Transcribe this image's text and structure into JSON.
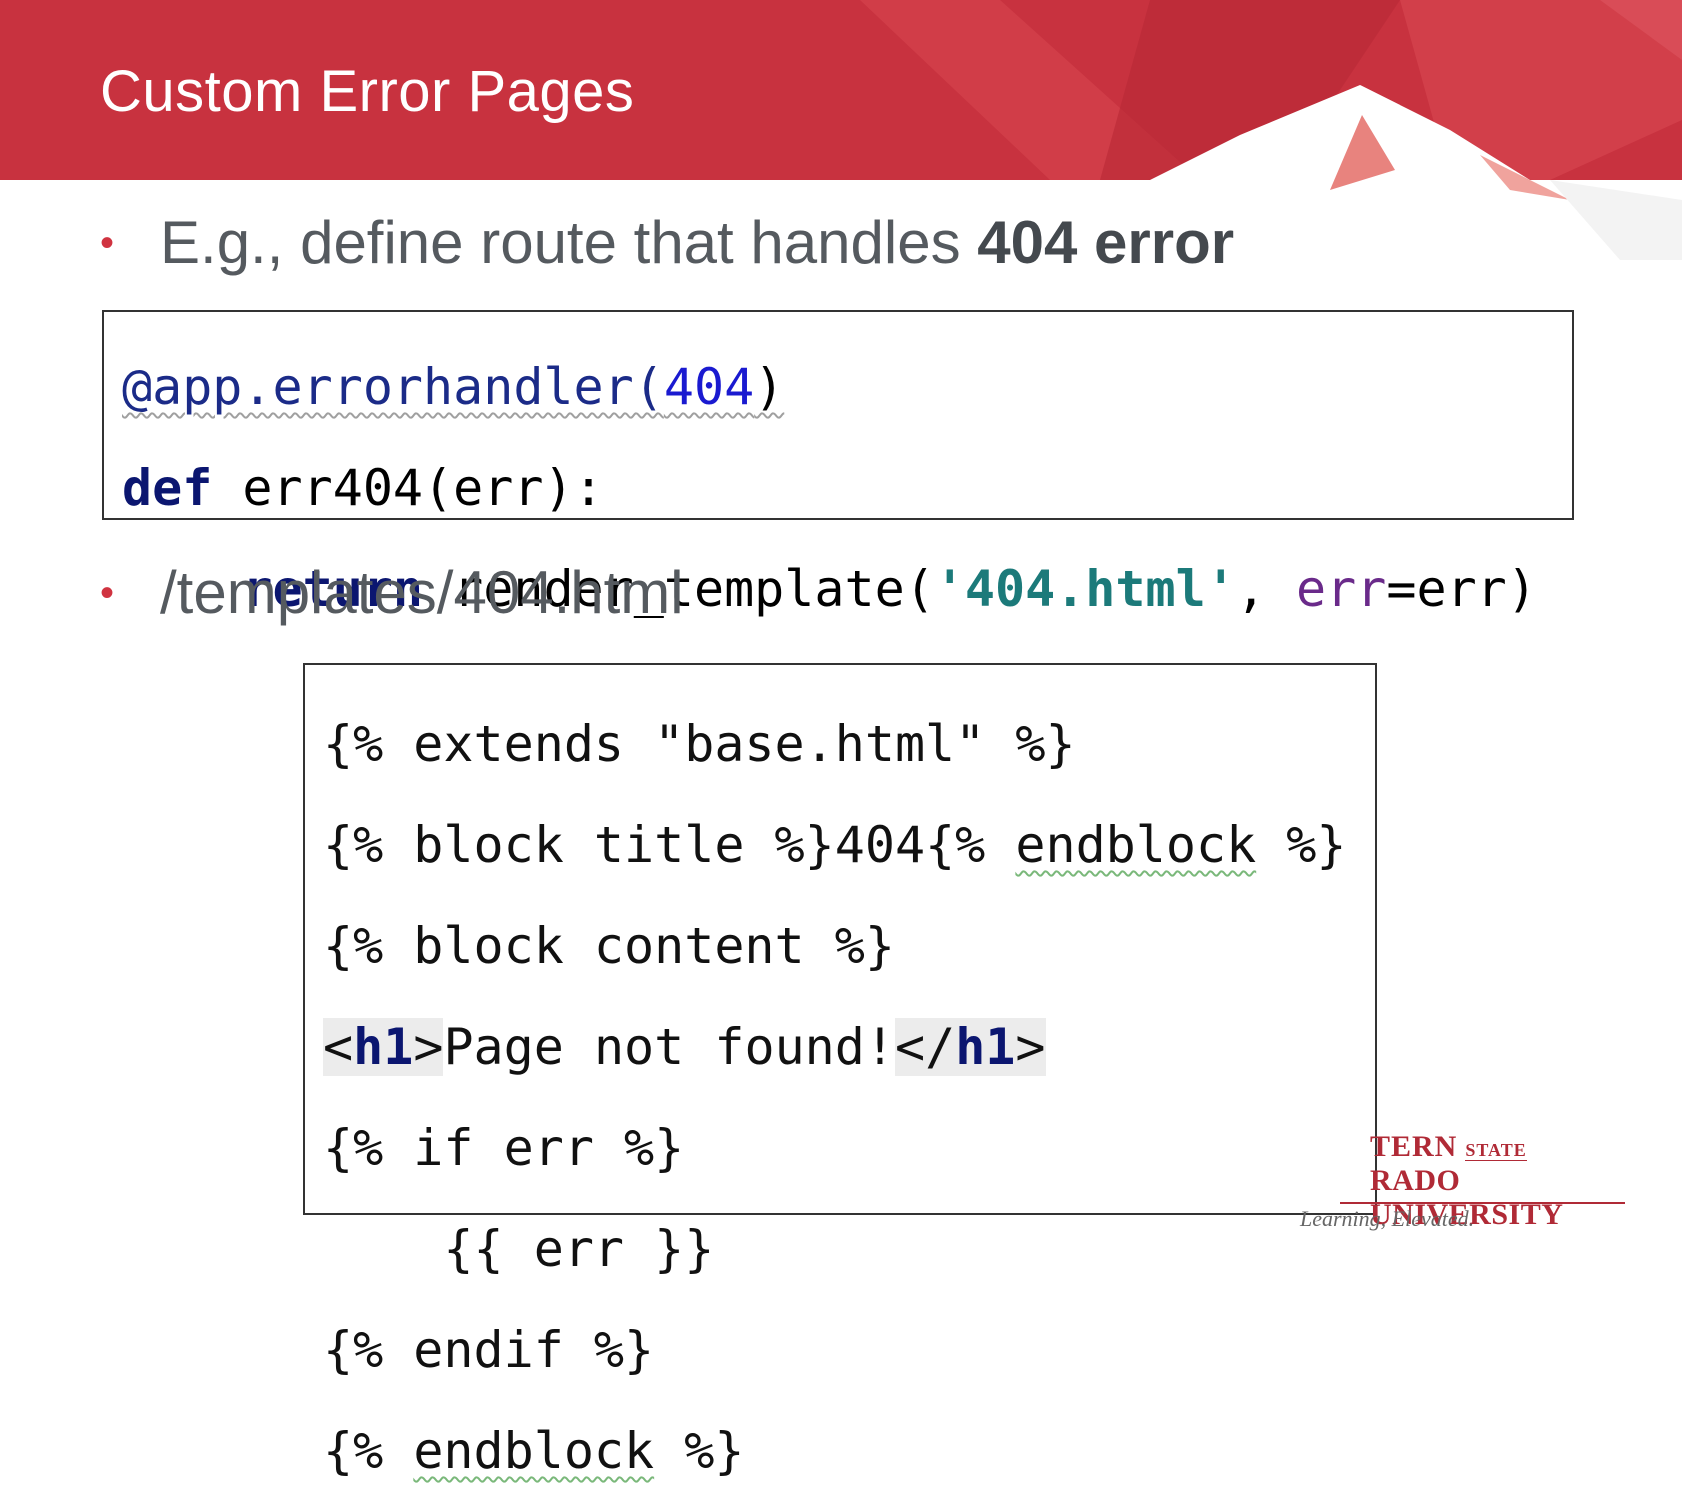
{
  "slide": {
    "title": "Custom Error Pages",
    "bullets": [
      {
        "prefix": "E.g., define route that handles ",
        "bold": "404 error"
      },
      {
        "prefix": "/templates/404.html",
        "bold": ""
      }
    ]
  },
  "code_python": {
    "line1": {
      "decorator": "@app.errorhandler(",
      "num": "404",
      "close": ")"
    },
    "line2": {
      "kw": "def",
      "rest": " err404(err):"
    },
    "line3": {
      "indent": "    ",
      "kw": "return",
      "mid": " render_template(",
      "str": "'404.html'",
      "comma": ", ",
      "param": "err",
      "end": "=err)"
    }
  },
  "code_template": {
    "line1": "{% extends \"base.html\" %}",
    "line2_a": "{% block title %}404{% ",
    "line2_b": "endblock",
    "line2_c": " %}",
    "line3": "{% block content %}",
    "line4": {
      "open_lt": "<",
      "open_tag": "h1",
      "open_gt": ">",
      "text": "Page not found!",
      "close_lt": "</",
      "close_tag": "h1",
      "close_gt": ">"
    },
    "line5": "{% if err %}",
    "line6": "    {{ err }}",
    "line7": "{% endif %}",
    "line8_a": "{% ",
    "line8_b": "endblock",
    "line8_c": " %}"
  },
  "logo": {
    "line1": "TERN",
    "line1_small": "STATE",
    "line2": "RADO UNIVERSITY",
    "tagline": "Learning, Elevated."
  },
  "colors": {
    "header": "#c8323f",
    "accent": "#d03340",
    "text": "#555a5f"
  }
}
